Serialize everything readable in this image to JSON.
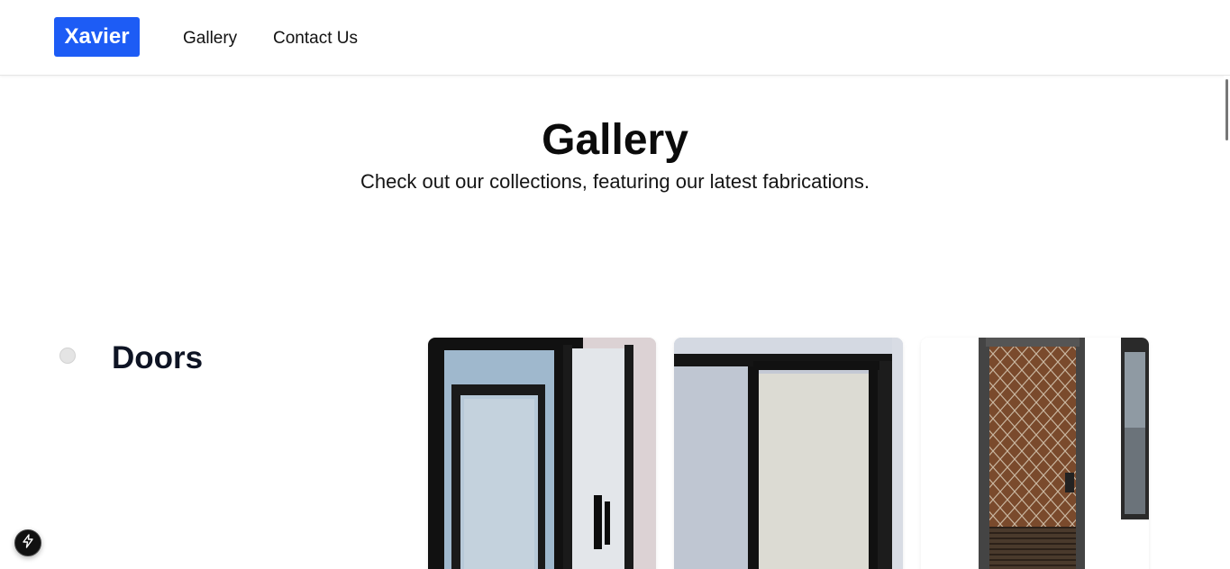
{
  "navbar": {
    "brand": "Xavier",
    "links": [
      {
        "label": "Gallery"
      },
      {
        "label": "Contact Us"
      }
    ]
  },
  "hero": {
    "title": "Gallery",
    "subtitle": "Check out our collections, featuring our latest fabrications."
  },
  "sections": [
    {
      "title": "Doors",
      "images": [
        {
          "kind": "frosted-glass-door"
        },
        {
          "kind": "sliding-glass-door"
        },
        {
          "kind": "security-mesh-door"
        }
      ]
    }
  ],
  "colors": {
    "brand": "#1d5cf5",
    "text": "#111111",
    "section_title": "#0e1424"
  },
  "icons": {
    "floating_button": "lightning-icon"
  }
}
